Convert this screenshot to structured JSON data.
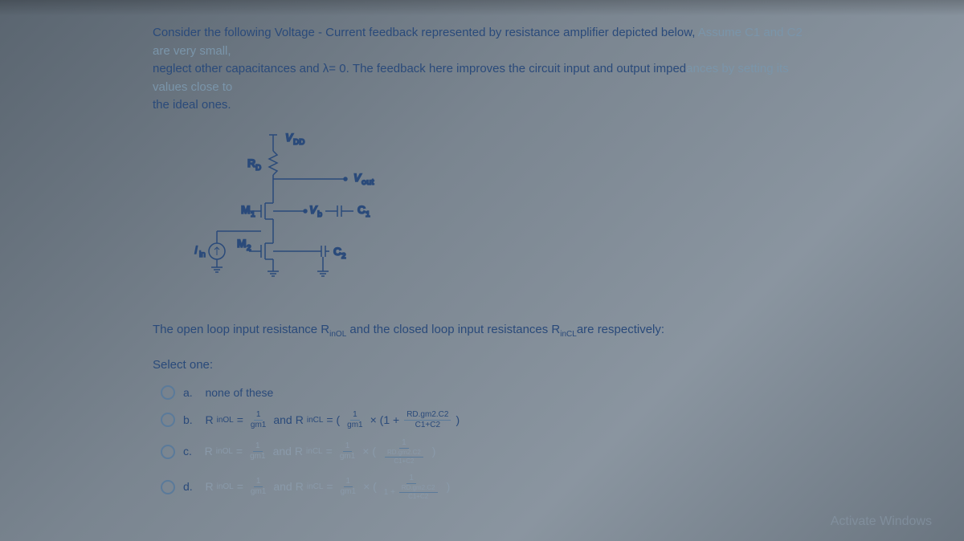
{
  "question": {
    "line1a": "Consider the following Voltage - Current feedback represented by resistance amplifier depicted below, ",
    "line1b": "Assume C1 and C2 are very small,",
    "line2a": "neglect other capacitances and λ= 0. The feedback here improves the circuit input and output imped",
    "line2b": "ances by setting its values close to",
    "line3": "the ideal ones."
  },
  "circuit": {
    "vdd": "V",
    "vdd_sub": "DD",
    "rd": "R",
    "rd_sub": "D",
    "vout": "V",
    "vout_sub": "out",
    "m1": "M",
    "m1_sub": "1",
    "vb": "V",
    "vb_sub": "b",
    "c1": "C",
    "c1_sub": "1",
    "iin": "I",
    "iin_sub": "in",
    "m2": "M",
    "m2_sub": "2",
    "c2": "C",
    "c2_sub": "2"
  },
  "prompt": "The open loop input resistance  R",
  "prompt_sub1": "inOL",
  "prompt2": " and the closed loop input resistances  R",
  "prompt_sub2": "inCL",
  "prompt3": "are respectively:",
  "select_one": "Select one:",
  "options": {
    "a": {
      "letter": "a.",
      "text": "none of these"
    },
    "b": {
      "letter": "b.",
      "r1": "R",
      "r1sub": "inOL",
      "eq1": " = ",
      "f1n": "1",
      "f1d": "gm1",
      "and": " and ",
      "r2": "R",
      "r2sub": "inCL",
      "eq2": "= (",
      "f2n": "1",
      "f2d": "gm1",
      "mid": " × (1 + ",
      "f3n": "RD.gm2.C2",
      "f3d": "C1+C2",
      "end": ")"
    },
    "c": {
      "letter": "c.",
      "r1": "R",
      "r1sub": "inOL",
      "eq1": " = ",
      "f1n": "1",
      "f1d": "gm1",
      "and": " and ",
      "r2": "R",
      "r2sub": "inCL",
      "eq2": "= ",
      "f2n": "1",
      "f2d": "gm1",
      "mid": " × (",
      "f3n": "1",
      "f3d_up": "RD.gm2.C2",
      "f3d_dn": "C1+C2",
      "end": ")"
    },
    "d": {
      "letter": "d.",
      "r1": "R",
      "r1sub": "inOL",
      "eq1": " = ",
      "f1n": "1",
      "f1d": "gm1",
      "and": " and ",
      "r2": "R",
      "r2sub": "inCL",
      "eq2": "= ",
      "f2n": "1",
      "f2d": "gm1",
      "mid": " × (",
      "f3n": "1",
      "f3d_up": "RD.gm2.C2",
      "f3d_dn": "C1+C2",
      "end": ")"
    }
  },
  "watermark": "Activate Windows"
}
